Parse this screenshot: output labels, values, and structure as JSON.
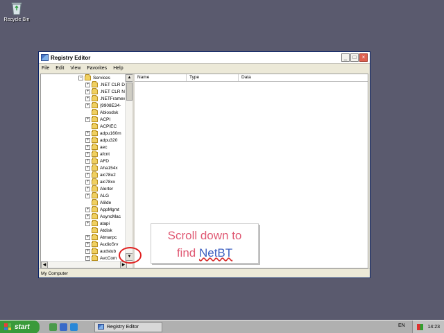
{
  "desktop": {
    "recycle_bin_label": "Recycle Bin"
  },
  "window": {
    "title": "Registry Editor",
    "controls": {
      "minimize": "_",
      "maximize": "□",
      "close": "×"
    },
    "menu": [
      "File",
      "Edit",
      "View",
      "Favorites",
      "Help"
    ],
    "tree": {
      "root": "Services",
      "items": [
        {
          "label": ".NET CLR Da",
          "expandable": true
        },
        {
          "label": ".NET CLR Ne",
          "expandable": true
        },
        {
          "label": ".NETFramew",
          "expandable": true
        },
        {
          "label": "{9908E34-",
          "expandable": true
        },
        {
          "label": "Abiosdsk",
          "expandable": false
        },
        {
          "label": "ACPI",
          "expandable": true
        },
        {
          "label": "ACPIEC",
          "expandable": false
        },
        {
          "label": "adpu160m",
          "expandable": true
        },
        {
          "label": "adpu320",
          "expandable": true
        },
        {
          "label": "aec",
          "expandable": true
        },
        {
          "label": "afcnt",
          "expandable": true
        },
        {
          "label": "AFD",
          "expandable": true
        },
        {
          "label": "Aha154x",
          "expandable": true
        },
        {
          "label": "aic78u2",
          "expandable": true
        },
        {
          "label": "aic78xx",
          "expandable": true
        },
        {
          "label": "Alerter",
          "expandable": true
        },
        {
          "label": "ALG",
          "expandable": true
        },
        {
          "label": "AliIde",
          "expandable": false
        },
        {
          "label": "AppMgmt",
          "expandable": true
        },
        {
          "label": "AsyncMac",
          "expandable": true
        },
        {
          "label": "atapi",
          "expandable": true
        },
        {
          "label": "Atdisk",
          "expandable": false
        },
        {
          "label": "Atmarpc",
          "expandable": true
        },
        {
          "label": "AudioSrv",
          "expandable": true
        },
        {
          "label": "audstub",
          "expandable": true
        },
        {
          "label": "AvcCom",
          "expandable": true
        }
      ]
    },
    "list_columns": [
      "Name",
      "Type",
      "Data"
    ],
    "status_text": "My Computer"
  },
  "callout": {
    "line1": "Scroll down to",
    "line2_prefix": "find ",
    "line2_highlight": "NetBT"
  },
  "taskbar": {
    "start_label": "start",
    "task_label": "Registry Editor",
    "lang": "EN",
    "clock": "14:23"
  },
  "colors": {
    "desktop": "#5a5a6e",
    "callout_text": "#e05a74",
    "highlight_text": "#3c5fc0",
    "annotation_circle": "#e02020"
  }
}
